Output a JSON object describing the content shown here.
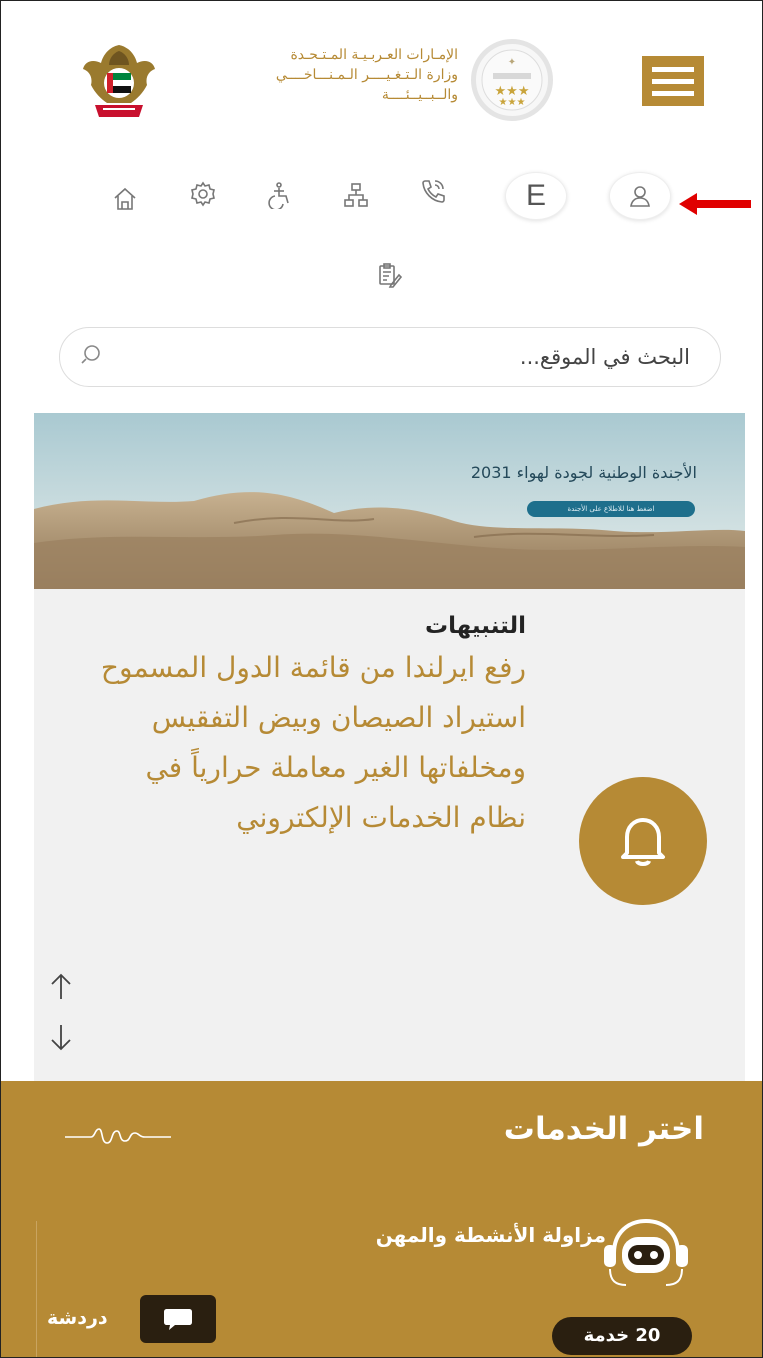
{
  "header": {
    "ministry_name_line1": "الإمـارات العـربـيـة المـتـحـدة",
    "ministry_name_line2": "وزارة الـتـغـيــــر الـمـنـــاخــــي",
    "ministry_name_line3": "والــبــيــئــــة",
    "menu_icon": "hamburger-icon",
    "colors": {
      "brand_gold": "#b68a35",
      "dark_pill": "#2a1f10",
      "arrow_red": "#e00000"
    }
  },
  "toolbar": {
    "items": [
      {
        "name": "home-icon"
      },
      {
        "name": "gear-icon"
      },
      {
        "name": "accessibility-icon"
      },
      {
        "name": "sitemap-icon"
      },
      {
        "name": "phone-icon"
      },
      {
        "name": "language",
        "label": "E"
      },
      {
        "name": "user-icon"
      },
      {
        "name": "feedback-icon"
      }
    ]
  },
  "search": {
    "placeholder": "البحث في الموقع..."
  },
  "banner": {
    "title": "الأجندة الوطنية لجودة لهواء 2031",
    "button": "اضغط هنا للاطلاع على الأجندة"
  },
  "alerts": {
    "title": "التنبيهات",
    "body": "رفع ايرلندا من قائمة الدول المسموح استيراد الصيصان وبيض التفقيس ومخلفاتها الغير معاملة حرارياً في نظام الخدمات الإلكتروني"
  },
  "services": {
    "title": "اختر الخدمات",
    "category_label": "مزاولة الأنشطة والمهن",
    "count_label": "20 خدمة",
    "chat_label": "دردشة"
  }
}
